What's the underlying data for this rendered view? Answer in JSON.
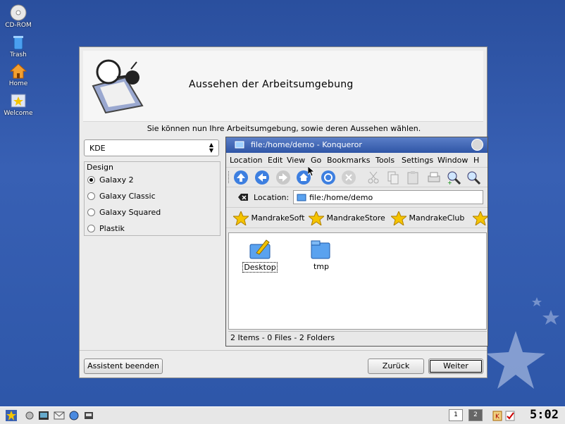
{
  "desktop": {
    "icons": [
      {
        "label": "CD-ROM",
        "icon": "cdrom-icon"
      },
      {
        "label": "Trash",
        "icon": "trash-icon"
      },
      {
        "label": "Home",
        "icon": "home-icon"
      },
      {
        "label": "Welcome",
        "icon": "welcome-icon"
      }
    ]
  },
  "wizard": {
    "title": "Aussehen der Arbeitsumgebung",
    "subtitle": "Sie können nun Ihre Arbeitsumgebung, sowie deren Aussehen wählen.",
    "environment_select": "KDE",
    "design_label": "Design",
    "design_options": [
      "Galaxy 2",
      "Galaxy Classic",
      "Galaxy Squared",
      "Plastik"
    ],
    "selected_design": "Galaxy 2",
    "buttons": {
      "quit": "Assistent beenden",
      "back": "Zurück",
      "next": "Weiter"
    }
  },
  "konqueror": {
    "window_title": "file:/home/demo - Konqueror",
    "menu": [
      "Location",
      "Edit",
      "View",
      "Go",
      "Bookmarks",
      "Tools",
      "Settings",
      "Window",
      "H"
    ],
    "location_label": "Location:",
    "location_value": "file:/home/demo",
    "bookmarks": [
      "MandrakeSoft",
      "MandrakeStore",
      "MandrakeClub"
    ],
    "files": [
      {
        "name": "Desktop",
        "icon": "desktop-folder-icon"
      },
      {
        "name": "tmp",
        "icon": "folder-icon"
      }
    ],
    "status": "2 Items - 0 Files - 2 Folders"
  },
  "taskbar": {
    "pager": [
      "1",
      "2"
    ],
    "active_desktop": "2",
    "clock": "5:02"
  },
  "colors": {
    "desktop": "#3860b4",
    "titlebar": "#3f66b8",
    "panel": "#ececec"
  }
}
